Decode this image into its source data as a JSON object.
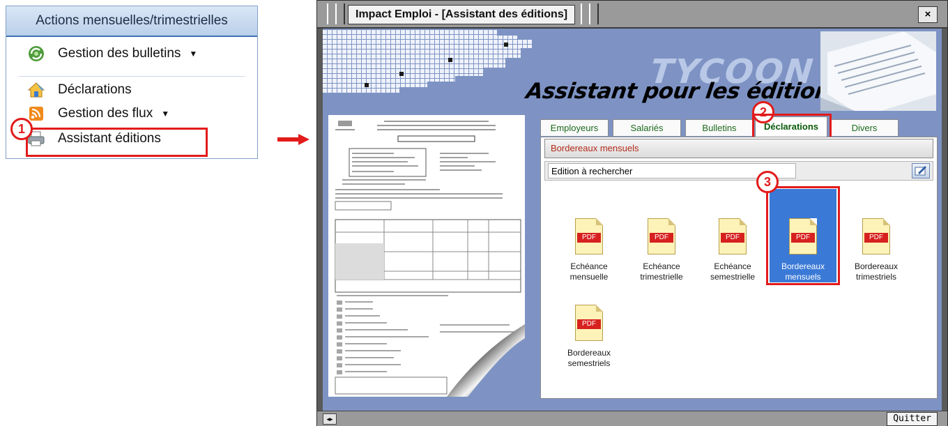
{
  "menu": {
    "header": "Actions mensuelles/trimestrielles",
    "items": [
      {
        "label": "Gestion des bulletins",
        "icon": "recycle-icon",
        "has_submenu": true
      },
      {
        "label": "Déclarations",
        "icon": "house-icon",
        "has_submenu": false
      },
      {
        "label": "Gestion des flux",
        "icon": "rss-feed-icon",
        "has_submenu": true
      },
      {
        "label": "Assistant éditions",
        "icon": "printer-icon",
        "has_submenu": false
      }
    ]
  },
  "callouts": [
    "1",
    "2",
    "3"
  ],
  "window": {
    "title": "Impact Emploi - [Assistant des éditions]",
    "close_label": "×",
    "brand": "TYCOON",
    "banner_title": "Assistant pour les éditions",
    "tabs": [
      {
        "label": "Employeurs",
        "active": false
      },
      {
        "label": "Salariés",
        "active": false
      },
      {
        "label": "Bulletins",
        "active": false
      },
      {
        "label": "Déclarations",
        "active": true
      },
      {
        "label": "Divers",
        "active": false
      }
    ],
    "section_title": "Bordereaux mensuels",
    "search_value": "Edition à rechercher",
    "pdf_badge": "PDF",
    "documents": [
      {
        "label": "Echéance mensuelle",
        "selected": false
      },
      {
        "label": "Echéance trimestrielle",
        "selected": false
      },
      {
        "label": "Echéance semestrielle",
        "selected": false
      },
      {
        "label": "Bordereaux mensuels",
        "selected": true
      },
      {
        "label": "Bordereaux trimestriels",
        "selected": false
      },
      {
        "label": "Bordereaux semestriels",
        "selected": false
      }
    ],
    "status_icon_label": "◂▸",
    "quit_label": "Quitter"
  },
  "colors": {
    "accent_red": "#e21b1b",
    "client_blue": "#7e93c4",
    "selection_blue": "#3a79d6",
    "tab_green": "#0a5a0a"
  }
}
